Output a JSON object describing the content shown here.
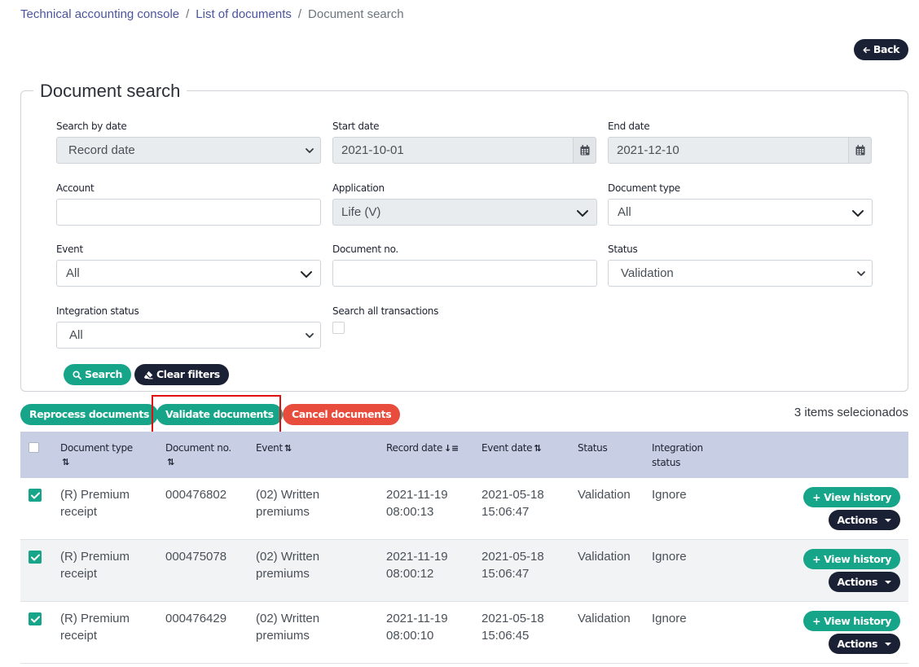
{
  "breadcrumb": {
    "items": [
      "Technical accounting console",
      "List of documents",
      "Document search"
    ],
    "separator": "/"
  },
  "back_button": "Back",
  "panel_title": "Document search",
  "filters": {
    "search_by_date": {
      "label": "Search by date",
      "value": "Record date"
    },
    "start_date": {
      "label": "Start date",
      "value": "2021-10-01"
    },
    "end_date": {
      "label": "End date",
      "value": "2021-12-10"
    },
    "account": {
      "label": "Account",
      "value": ""
    },
    "application": {
      "label": "Application",
      "value": "Life (V)"
    },
    "document_type": {
      "label": "Document type",
      "value": "All"
    },
    "event": {
      "label": "Event",
      "value": "All"
    },
    "document_no": {
      "label": "Document no.",
      "value": ""
    },
    "status": {
      "label": "Status",
      "value": "Validation"
    },
    "integration_status": {
      "label": "Integration status",
      "value": "All"
    },
    "search_all_transactions": {
      "label": "Search all transactions",
      "checked": false
    }
  },
  "buttons": {
    "search": "Search",
    "clear_filters": "Clear filters",
    "reprocess": "Reprocess documents",
    "validate": "Validate documents",
    "cancel": "Cancel documents"
  },
  "selected_count_text": "3 items selecionados",
  "table": {
    "columns": {
      "document_type": "Document type",
      "document_no": "Document no.",
      "event": "Event",
      "record_date": "Record date",
      "event_date": "Event date",
      "status": "Status",
      "integration_status_1": "Integration",
      "integration_status_2": "status"
    },
    "rows": [
      {
        "doc_type_1": "(R) Premium",
        "doc_type_2": "receipt",
        "doc_no": "000476802",
        "event_1": "(02) Written",
        "event_2": "premiums",
        "record_date_1": "2021-11-19",
        "record_date_2": "08:00:13",
        "event_date_1": "2021-05-18",
        "event_date_2": "15:06:47",
        "status": "Validation",
        "integration": "Ignore",
        "checked": true
      },
      {
        "doc_type_1": "(R) Premium",
        "doc_type_2": "receipt",
        "doc_no": "000475078",
        "event_1": "(02) Written",
        "event_2": "premiums",
        "record_date_1": "2021-11-19",
        "record_date_2": "08:00:12",
        "event_date_1": "2021-05-18",
        "event_date_2": "15:06:47",
        "status": "Validation",
        "integration": "Ignore",
        "checked": true
      },
      {
        "doc_type_1": "(R) Premium",
        "doc_type_2": "receipt",
        "doc_no": "000476429",
        "event_1": "(02) Written",
        "event_2": "premiums",
        "record_date_1": "2021-11-19",
        "record_date_2": "08:00:10",
        "event_date_1": "2021-05-18",
        "event_date_2": "15:06:45",
        "status": "Validation",
        "integration": "Ignore",
        "checked": true
      }
    ],
    "row_buttons": {
      "view_history": "View history",
      "actions": "Actions"
    }
  },
  "colors": {
    "teal": "#17a589",
    "dark": "#1b2134",
    "red": "#e74c3c",
    "header_bg": "#c8cfe4",
    "highlight": "#e01010"
  }
}
